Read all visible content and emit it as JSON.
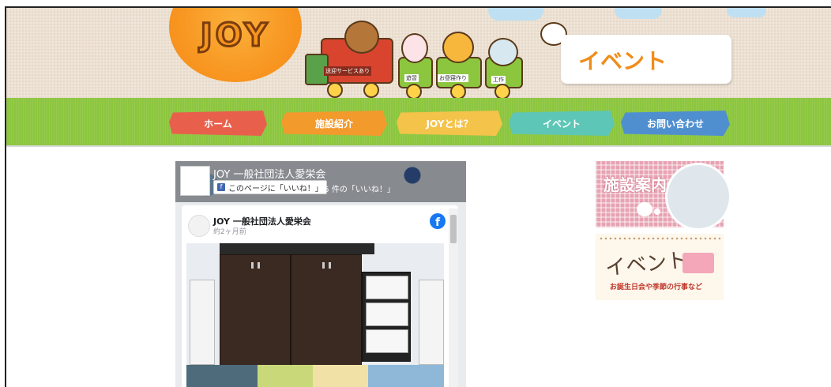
{
  "header": {
    "logo_text": "JOY",
    "page_title": "イベント",
    "train_signs": [
      "送迎サービスあり",
      "遊習",
      "お昼寝作り",
      "工作"
    ]
  },
  "nav": {
    "items": [
      {
        "label": "ホーム",
        "color": "#e8604c"
      },
      {
        "label": "施設紹介",
        "color": "#f39a2c"
      },
      {
        "label": "JOYとは？",
        "color": "#f4c34a"
      },
      {
        "label": "イベント",
        "color": "#5ec6b6"
      },
      {
        "label": "お問い合わせ",
        "color": "#4f8fd0"
      }
    ]
  },
  "facebook": {
    "page_name": "JOY 一般社団法人愛栄会",
    "like_button": "このページに「いいね！」",
    "like_count": "15 件の「いいね！」",
    "post": {
      "author": "JOY 一般社団法人愛栄会",
      "time": "約2ヶ月前"
    },
    "fb_icon": "facebook-icon"
  },
  "sidebar": {
    "banner1_label": "施設案内",
    "banner2_label": "イベント",
    "banner2_sub": "お誕生日会や季節の行事など"
  }
}
